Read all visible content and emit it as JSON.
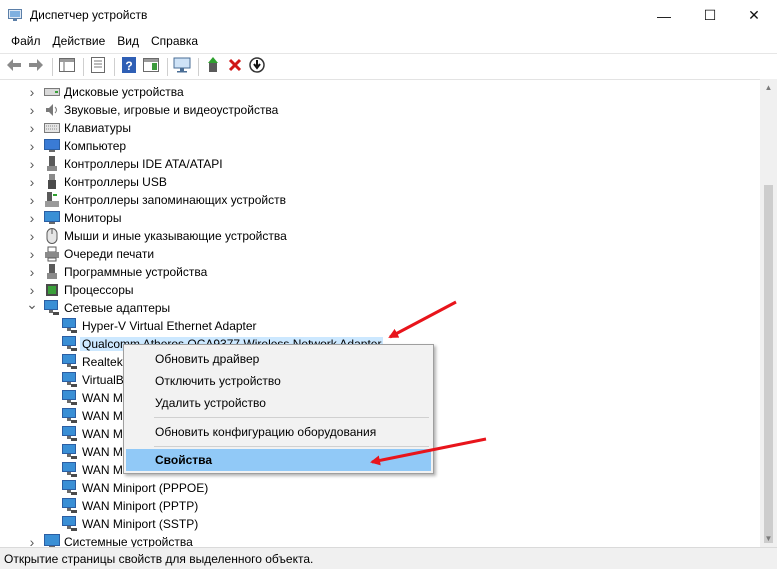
{
  "window": {
    "title": "Диспетчер устройств",
    "minimize_glyph": "—",
    "maximize_glyph": "☐",
    "close_glyph": "✕"
  },
  "menu": {
    "items": [
      "Файл",
      "Действие",
      "Вид",
      "Справка"
    ]
  },
  "toolbar": {
    "icons": [
      "back-icon",
      "forward-icon",
      "show-hide-console-tree-icon",
      "properties-icon",
      "help-icon",
      "action-pane-icon",
      "scan-hardware-icon",
      "update-driver-icon",
      "uninstall-device-icon",
      "disable-device-icon"
    ]
  },
  "tree": {
    "categories": [
      {
        "label": "Дисковые устройства",
        "icon": "disk-drive-icon",
        "expanded": false
      },
      {
        "label": "Звуковые, игровые и видеоустройства",
        "icon": "speaker-icon",
        "expanded": false
      },
      {
        "label": "Клавиатуры",
        "icon": "keyboard-icon",
        "expanded": false
      },
      {
        "label": "Компьютер",
        "icon": "computer-icon",
        "expanded": false
      },
      {
        "label": "Контроллеры IDE ATA/ATAPI",
        "icon": "ide-controller-icon",
        "expanded": false
      },
      {
        "label": "Контроллеры USB",
        "icon": "usb-icon",
        "expanded": false
      },
      {
        "label": "Контроллеры запоминающих устройств",
        "icon": "storage-controller-icon",
        "expanded": false
      },
      {
        "label": "Мониторы",
        "icon": "monitor-icon",
        "expanded": false
      },
      {
        "label": "Мыши и иные указывающие устройства",
        "icon": "mouse-icon",
        "expanded": false
      },
      {
        "label": "Очереди печати",
        "icon": "printer-icon",
        "expanded": false
      },
      {
        "label": "Программные устройства",
        "icon": "software-device-icon",
        "expanded": false
      },
      {
        "label": "Процессоры",
        "icon": "processor-icon",
        "expanded": false
      },
      {
        "label": "Сетевые адаптеры",
        "icon": "network-adapter-icon",
        "expanded": true
      }
    ],
    "adapters": [
      {
        "label": "Hyper-V Virtual Ethernet Adapter",
        "selected": false
      },
      {
        "label": "Qualcomm Atheros QCA9377 Wireless Network Adapter",
        "selected": true
      },
      {
        "label": "Realtek",
        "selected": false
      },
      {
        "label": "VirtualB",
        "selected": false
      },
      {
        "label": "WAN M",
        "selected": false
      },
      {
        "label": "WAN M",
        "selected": false
      },
      {
        "label": "WAN M",
        "selected": false
      },
      {
        "label": "WAN M",
        "selected": false
      },
      {
        "label": "WAN M",
        "selected": false
      },
      {
        "label": "WAN Miniport (PPPOE)",
        "selected": false
      },
      {
        "label": "WAN Miniport (PPTP)",
        "selected": false
      },
      {
        "label": "WAN Miniport (SSTP)",
        "selected": false
      }
    ],
    "trailing_category": {
      "label": "Системные устройства",
      "icon": "system-device-icon"
    }
  },
  "context_menu": {
    "update_driver": "Обновить драйвер",
    "disable_device": "Отключить устройство",
    "uninstall_device": "Удалить устройство",
    "scan_hardware": "Обновить конфигурацию оборудования",
    "properties": "Свойства"
  },
  "status": {
    "text": "Открытие страницы свойств для выделенного объекта."
  },
  "colors": {
    "annotation_arrow": "#e8141b",
    "hover_highlight": "#91c9f7",
    "selection": "#cce8ff"
  }
}
